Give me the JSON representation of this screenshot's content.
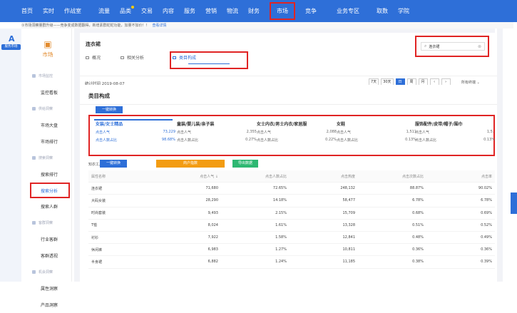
{
  "topnav": {
    "items": [
      {
        "label": "首页"
      },
      {
        "label": "实时"
      },
      {
        "label": "作战室"
      },
      {
        "label": "流量"
      },
      {
        "label": "品类"
      },
      {
        "label": "交易"
      },
      {
        "label": "内容"
      },
      {
        "label": "服务"
      },
      {
        "label": "营销"
      },
      {
        "label": "物流"
      },
      {
        "label": "财务"
      },
      {
        "label": "市场"
      },
      {
        "label": "竞争"
      },
      {
        "label": "业务专区"
      },
      {
        "label": "取数"
      },
      {
        "label": "学院"
      }
    ]
  },
  "notice": {
    "text": "①市场洞察量群升级——竞争变成数据翻得，新增素群蛇蛇功能，加量不加价！！",
    "link": "查看详情"
  },
  "leftrail": {
    "tag": "服务市场"
  },
  "sidebar": {
    "title": "市场",
    "rows": [
      {
        "type": "group",
        "label": "市场监控"
      },
      {
        "type": "leaf",
        "label": "监控看板"
      },
      {
        "type": "group",
        "label": "供给洞察"
      },
      {
        "type": "leaf",
        "label": "市场大盘"
      },
      {
        "type": "leaf",
        "label": "市场排行"
      },
      {
        "type": "group",
        "label": "搜索洞察"
      },
      {
        "type": "leaf",
        "label": "搜索排行"
      },
      {
        "type": "leaf",
        "label": "搜索分析",
        "active": true
      },
      {
        "type": "leaf",
        "label": "搜索人群"
      },
      {
        "type": "group",
        "label": "客群洞察"
      },
      {
        "type": "leaf",
        "label": "行业客群"
      },
      {
        "type": "leaf",
        "label": "客群透视"
      },
      {
        "type": "group",
        "label": "机会洞察"
      },
      {
        "type": "leaf",
        "label": "属性洞察"
      },
      {
        "type": "leaf",
        "label": "产品洞察"
      }
    ]
  },
  "search": {
    "keyword": "连衣裙",
    "value": "连衣裙"
  },
  "tabs": [
    {
      "label": "概况"
    },
    {
      "label": "相关分析"
    },
    {
      "label": "类目构成",
      "active": true
    }
  ],
  "statbar": {
    "stat_time": "统计时间 2019-08-07",
    "dates": [
      "7天",
      "30天",
      "日",
      "周",
      "月"
    ],
    "active_date": "日",
    "source": "所有终端"
  },
  "section": {
    "title": "类目构成",
    "convert_label": "一键转换"
  },
  "categories": [
    {
      "name": "女装/女士精品",
      "k1": "点击人气",
      "v1": "73,229",
      "k2": "点击人数占比",
      "v2": "98.68%",
      "active": true
    },
    {
      "name": "童装/婴儿装/亲子装",
      "k1": "点击人气",
      "v1": "2,355",
      "k2": "点击人数占比",
      "v2": "0.27%"
    },
    {
      "name": "女士内衣/男士内衣/家居服",
      "k1": "点击人气",
      "v1": "2,088",
      "k2": "点击人数占比",
      "v2": "0.22%"
    },
    {
      "name": "女鞋",
      "k1": "点击人气",
      "v1": "1,511",
      "k2": "点击人数占比",
      "v2": "0.13%"
    },
    {
      "name": "服饰配件/皮带/帽子/围巾",
      "k1": "点击人气",
      "v1": "1,5..",
      "k2": "点击人数占比",
      "v2": "0.13%"
    }
  ],
  "tools": {
    "label": "知衣工具",
    "convert": "一键转换",
    "goods": "商户指数",
    "export": "导出数据"
  },
  "table": {
    "headers": [
      "属性名称",
      "点击人气 ↓",
      "点击人数占比",
      "点击热度",
      "点击次数占比",
      "点击率"
    ],
    "rows": [
      [
        "连衣裙",
        "71,680",
        "72.65%",
        "248,132",
        "88.87%",
        "90.02%"
      ],
      [
        "大码女装",
        "28,290",
        "14.18%",
        "58,477",
        "6.78%",
        "6.78%"
      ],
      [
        "时尚套装",
        "9,493",
        "2.15%",
        "15,709",
        "0.68%",
        "0.69%"
      ],
      [
        "T恤",
        "8,024",
        "1.61%",
        "13,328",
        "0.51%",
        "0.52%"
      ],
      [
        "衬衫",
        "7,922",
        "1.58%",
        "12,841",
        "0.48%",
        "0.49%"
      ],
      [
        "休闲裤",
        "6,983",
        "1.27%",
        "10,811",
        "0.36%",
        "0.36%"
      ],
      [
        "半身裙",
        "6,882",
        "1.24%",
        "11,185",
        "0.38%",
        "0.39%"
      ]
    ]
  }
}
